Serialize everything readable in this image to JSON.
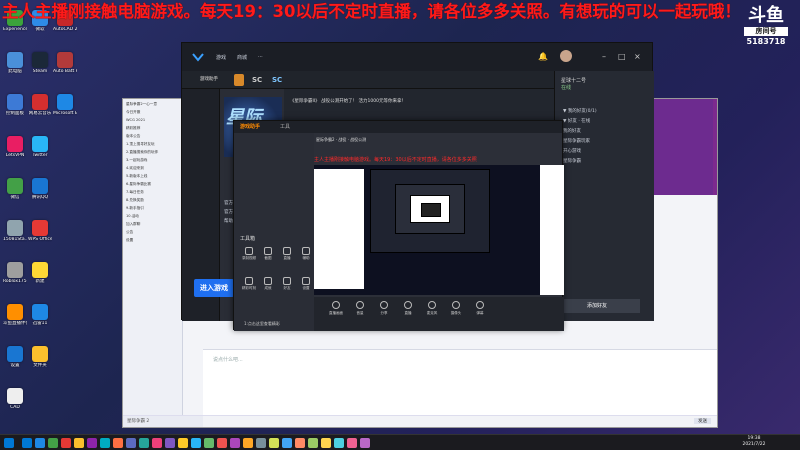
{
  "banner": {
    "text": "主人主播刚接触电脑游戏。每天19：30以后不定时直播，请各位多多关照。有想玩的可以一起玩哦！"
  },
  "douyu": {
    "logo": "斗鱼",
    "room_label": "房间号",
    "room_number": "5183718"
  },
  "desktop_icons": [
    {
      "name": "Experience",
      "color": "#3ba33b"
    },
    {
      "name": "微软",
      "color": "#2e8be6"
    },
    {
      "name": "AutoCAD 2014 - 简...",
      "color": "#c62828"
    },
    {
      "name": "此电脑",
      "color": "#4a90d9"
    },
    {
      "name": "Steam",
      "color": "#1b2838"
    },
    {
      "name": "Auto Batt ReCap",
      "color": "#b23a3a"
    },
    {
      "name": "控制面板",
      "color": "#3d7ad6"
    },
    {
      "name": "网易云音乐",
      "color": "#d32f2f"
    },
    {
      "name": "Microsoft Edge",
      "color": "#1e88e5"
    },
    {
      "name": "LetsVPN",
      "color": "#e91e63"
    },
    {
      "name": "Twitter",
      "color": "#29b6f6"
    },
    {
      "name": "YY语音",
      "color": "#ffb300"
    },
    {
      "name": "微信",
      "color": "#43a047"
    },
    {
      "name": "腾讯QQ",
      "color": "#1976d2"
    },
    {
      "name": "2021-0405...",
      "color": "#8d6e63"
    },
    {
      "name": "15081Sta...",
      "color": "#90a4ae"
    },
    {
      "name": "WPS Office",
      "color": "#e53935"
    },
    {
      "name": "斗鱼直播",
      "color": "#ff7043"
    },
    {
      "name": "Roblox175...",
      "color": "#9e9e9e"
    },
    {
      "name": "新建",
      "color": "#fdd835"
    },
    {
      "name": "a69a7f821...",
      "color": "#757575"
    },
    {
      "name": "斗鱼直播伴侣",
      "color": "#ff8f00"
    },
    {
      "name": "迅雷11",
      "color": "#1e88e5"
    },
    {
      "name": "949ff6...",
      "color": "#bdbdbd"
    },
    {
      "name": "设置",
      "color": "#1976d2"
    },
    {
      "name": "文件夹",
      "color": "#fbc02d"
    },
    {
      "name": "迅雷加速",
      "color": "#1565c0"
    },
    {
      "name": "CAD",
      "color": "#eeeeee"
    }
  ],
  "browser": {
    "brand": "星际",
    "sidebar_rows": [
      "星际争霸2一心一意",
      "今日开服",
      "WCG 2021",
      "精彩推荐",
      "版本公告",
      "1.顶上搜寻好友玩",
      "2.直播搜索你的玩伴",
      "3.一起玩游戏",
      "4.欢迎来到",
      "5.新版本上线",
      "6.星际争霸比赛",
      "7.每日任务",
      "8.兑换奖励",
      "9.新手指引",
      "10.活动",
      "加入群聊",
      "公告",
      "设置"
    ],
    "compose_placeholder": "说点什么吧...",
    "compose_bar_left": "星际争霸 2",
    "compose_bar_right": "发送"
  },
  "wegame": {
    "nav": [
      "游戏",
      "商城",
      "···"
    ],
    "tabs": [
      "游戏助手",
      "",
      "SC",
      "SC"
    ],
    "user_name": "星球十二号",
    "user_status": "在线",
    "notice": "《星际争霸II》 战役公测开始了！ 活力1000元等你来拿！",
    "game_logo": "星际",
    "start_button": "进入游戏",
    "left_links": [
      "官方论坛",
      "官方网站",
      "帮助中心"
    ],
    "friend_groups": [
      "▼ 我的好友(0/1)",
      "▼ 好友 · 在线",
      "我的好友",
      "星际争霸玩家",
      "开心游戏",
      "星际争霸"
    ],
    "add_friend": "添加好友",
    "window_controls": [
      "–",
      "□",
      "×"
    ]
  },
  "stream": {
    "tabs": [
      "游戏助手",
      "工具"
    ],
    "notice": "星际争霸2 · 战役 · 战役公测",
    "red_text": "主人主播刚接触电脑游戏。每天19：30以后不定时直播，请各位多多关照",
    "tool_label": "工具箱",
    "tools": [
      "录制视频",
      "截图",
      "直播",
      "辅助",
      "精彩时刻",
      "成就",
      "好友",
      "设置"
    ],
    "bottom_buttons": [
      "直播画面",
      "音量",
      "分享",
      "直播",
      "麦克风",
      "摄像头",
      "弹幕"
    ],
    "bottom_status": "1:点击这里查看精彩"
  },
  "taskbar": {
    "time": "19:38",
    "date": "2021/7/22",
    "icon_colors": [
      "#0078d4",
      "#1e88e5",
      "#43a047",
      "#e53935",
      "#fbc02d",
      "#8e24aa",
      "#00acc1",
      "#ff7043",
      "#5c6bc0",
      "#26a69a",
      "#ec407a",
      "#7e57c2",
      "#ffca28",
      "#29b6f6",
      "#66bb6a",
      "#ef5350",
      "#ab47bc",
      "#ffa726",
      "#78909c",
      "#d4e157",
      "#42a5f5",
      "#ff8a65",
      "#9ccc65",
      "#ffd54f",
      "#4dd0e1",
      "#f06292",
      "#ba68c8"
    ]
  }
}
